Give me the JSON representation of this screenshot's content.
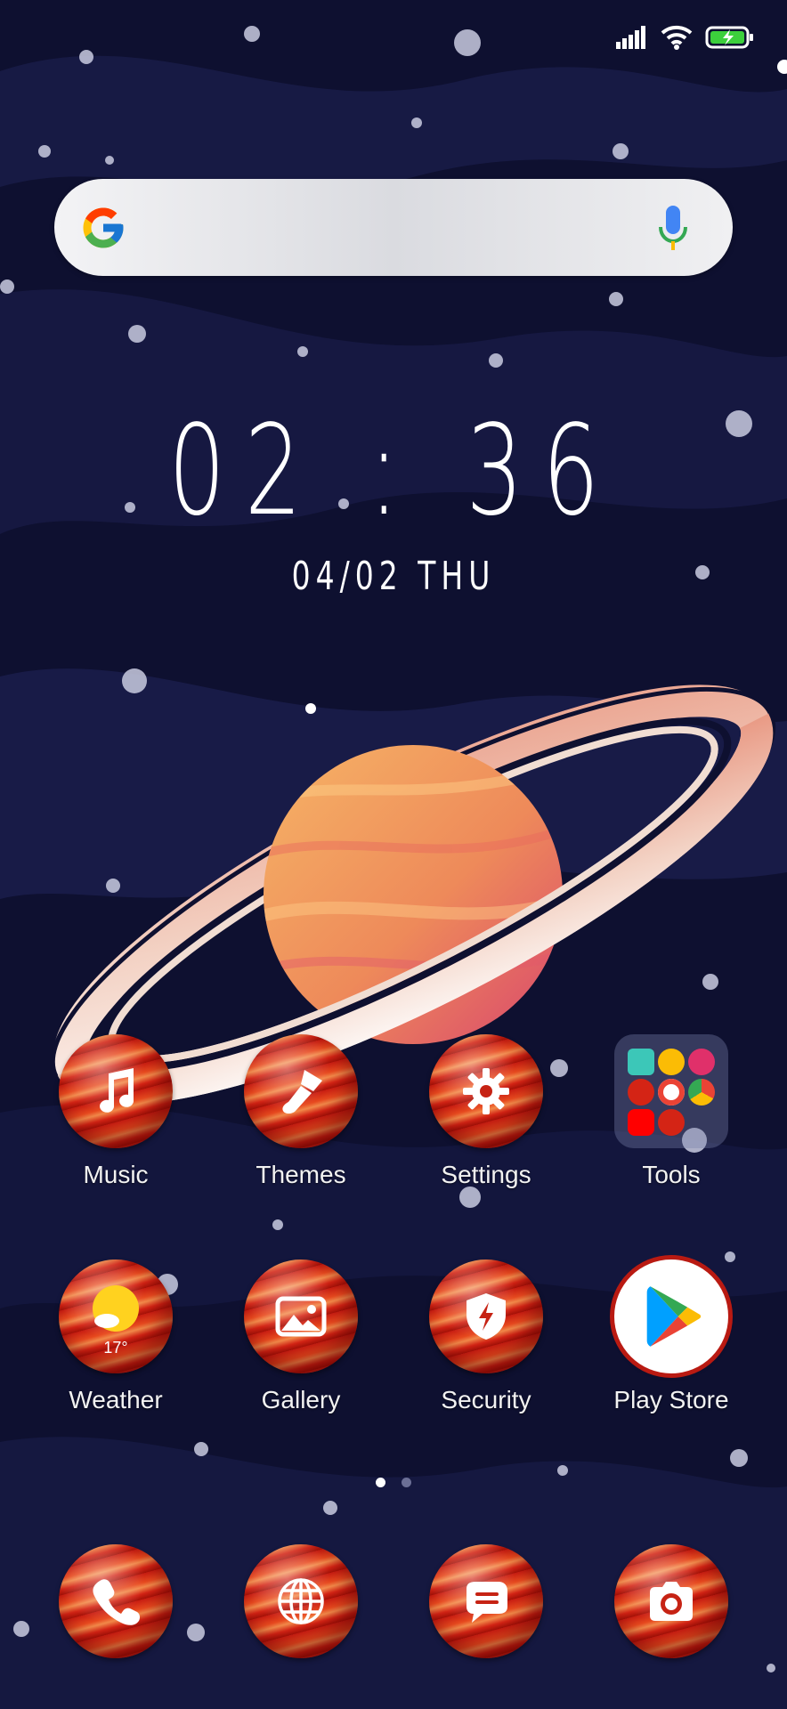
{
  "status_bar": {
    "signal_icon": "signal-bars-icon",
    "wifi_icon": "wifi-icon",
    "battery_icon": "battery-charging-icon",
    "battery_color": "#3ccf3c"
  },
  "search": {
    "logo": "google-g-icon",
    "mic": "microphone-icon"
  },
  "clock": {
    "time": "02 : 36",
    "date": "04/02 THU"
  },
  "apps": [
    {
      "label": "Music",
      "icon": "music-note-icon"
    },
    {
      "label": "Themes",
      "icon": "paintbrush-icon"
    },
    {
      "label": "Settings",
      "icon": "gear-icon"
    },
    {
      "label": "Tools",
      "icon": "folder-icon"
    },
    {
      "label": "Weather",
      "icon": "sun-icon",
      "temperature": "17°"
    },
    {
      "label": "Gallery",
      "icon": "image-icon"
    },
    {
      "label": "Security",
      "icon": "shield-bolt-icon"
    },
    {
      "label": "Play Store",
      "icon": "play-store-icon"
    }
  ],
  "dock": [
    {
      "icon": "phone-icon"
    },
    {
      "icon": "globe-icon"
    },
    {
      "icon": "message-icon"
    },
    {
      "icon": "camera-icon"
    }
  ],
  "pages": {
    "count": 2,
    "active": 1
  },
  "colors": {
    "background": "#0e1030",
    "icon_red": "#d42415",
    "planet_orange": "#f2a15c",
    "planet_pink": "#d9466d"
  }
}
